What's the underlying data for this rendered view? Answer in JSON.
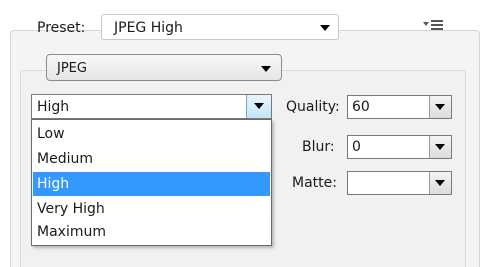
{
  "preset": {
    "label": "Preset:",
    "value": "JPEG High"
  },
  "format": {
    "value": "JPEG"
  },
  "quality_preset": {
    "value": "High",
    "options": [
      {
        "label": "Low"
      },
      {
        "label": "Medium"
      },
      {
        "label": "High",
        "selected": true
      },
      {
        "label": "Very High"
      },
      {
        "label": "Maximum"
      }
    ]
  },
  "quality": {
    "label": "Quality:",
    "value": "60"
  },
  "blur": {
    "label": "Blur:",
    "value": "0"
  },
  "matte": {
    "label": "Matte:",
    "value": ""
  },
  "colors": {
    "selection": "#3399ff",
    "combo_button": "#c6e4f7"
  },
  "icons": {
    "panel_menu": "panel-menu-icon",
    "dropdown_caret": "chevron-down-icon"
  }
}
